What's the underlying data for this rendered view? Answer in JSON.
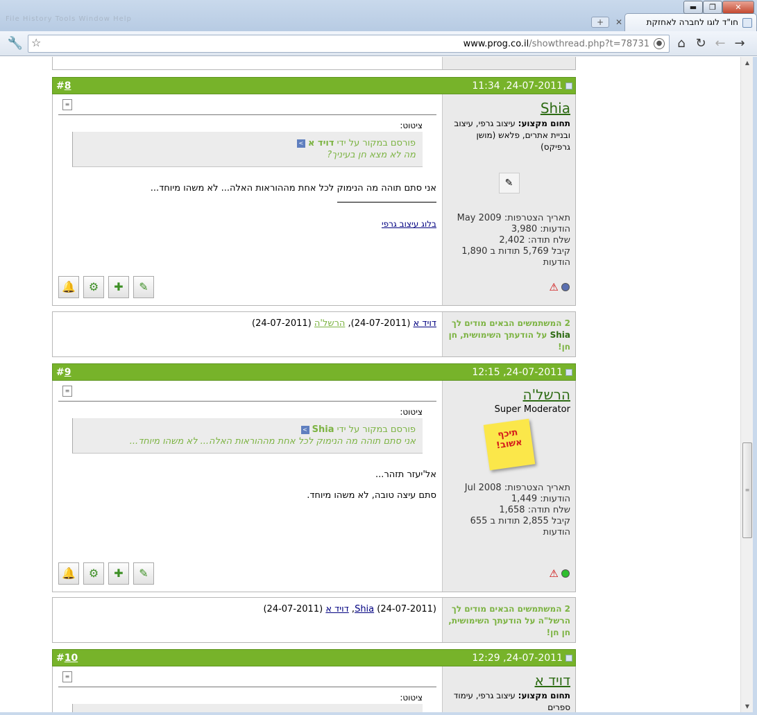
{
  "browser": {
    "tab_title": "חו\"ד לוגו לחברה לאחזקת",
    "url_host": "www.prog.co.il",
    "url_path": "/showthread.php?t=78731",
    "controls": {
      "minimize": "▬",
      "maximize": "❐",
      "close": "✕"
    }
  },
  "posts": [
    {
      "number": "8",
      "date": "24-07-2011, 11:34",
      "user": {
        "name": "Shia",
        "specialty_label": "תחום מקצוע:",
        "specialty": "עיצוב גרפי, עיצוב ובניית אתרים, פלאש (מושן גרפיקס)",
        "joined": "תאריך הצטרפות: May 2009",
        "posts": "הודעות: 3,980",
        "thanks_sent": "שלח תודה: 2,402",
        "thanks_received": "קיבל 5,769 תודות ב 1,890 הודעות",
        "status_color": "#5a6fb0"
      },
      "quote_label": "ציטוט:",
      "quote_source": "פורסם במקור על ידי ",
      "quote_author": "דויד א",
      "quote_text": "מה לא מצא חן בעיניך?",
      "message_lines": [
        "אני סתם תוהה מה הנימוק לכל אחת מההוראות האלה... לא משהו מיוחד..."
      ],
      "signature": "בלוג עיצוב גרפי"
    },
    {
      "number": "9",
      "date": "24-07-2011, 12:15",
      "user": {
        "name": "הרשל'ה",
        "title": "Super Moderator",
        "avatar_text": "תיכף אשוב!",
        "joined": "תאריך הצטרפות: Jul 2008",
        "posts": "הודעות: 1,449",
        "thanks_sent": "שלח תודה: 1,658",
        "thanks_received": "קיבל 2,855 תודות ב 655 הודעות",
        "status_color": "#2fbf2f"
      },
      "quote_label": "ציטוט:",
      "quote_source": "פורסם במקור על ידי ",
      "quote_author": "Shia",
      "quote_text": "אני סתם תוהה מה הנימוק לכל אחת מההוראות האלה... לא משהו מיוחד...",
      "message_lines": [
        "אל'יעזר תזהר...",
        "סתם עיצה טובה, לא משהו מיוחד."
      ]
    },
    {
      "number": "10",
      "date": "24-07-2011, 12:29",
      "user": {
        "name": "דויד א",
        "specialty_label": "תחום מקצוע:",
        "specialty": "עיצוב גרפי, עימוד ספרים"
      },
      "quote_label": "ציטוט:"
    }
  ],
  "thanks": [
    {
      "title_prefix": "2 המשתמשים הבאים מודים לך",
      "title_user": "Shia",
      "title_suffix": "על הודעתך השימושית, חן חן!",
      "users": [
        {
          "name": "דויד א",
          "date": "(24-07-2011)"
        },
        {
          "name": "הרשל'ה",
          "date": "(24-07-2011)"
        }
      ]
    },
    {
      "title_prefix": "2 המשתמשים הבאים מודים לך",
      "title_user": "הרשל\"ה",
      "title_suffix": "על הודעתך השימושית, חן חן!",
      "users": [
        {
          "name": "Shia",
          "date": "(24-07-2011)"
        },
        {
          "name": "דויד א",
          "date": "(24-07-2011)"
        }
      ]
    }
  ],
  "icons": [
    "settings-wrench-icon",
    "bookmark-star-icon",
    "globe-icon",
    "home-icon",
    "reload-icon",
    "back-icon",
    "forward-icon",
    "post-doc-icon",
    "bell-icon",
    "gear-icon",
    "multiquote-icon",
    "quote-icon",
    "report-icon",
    "online-status-icon"
  ]
}
